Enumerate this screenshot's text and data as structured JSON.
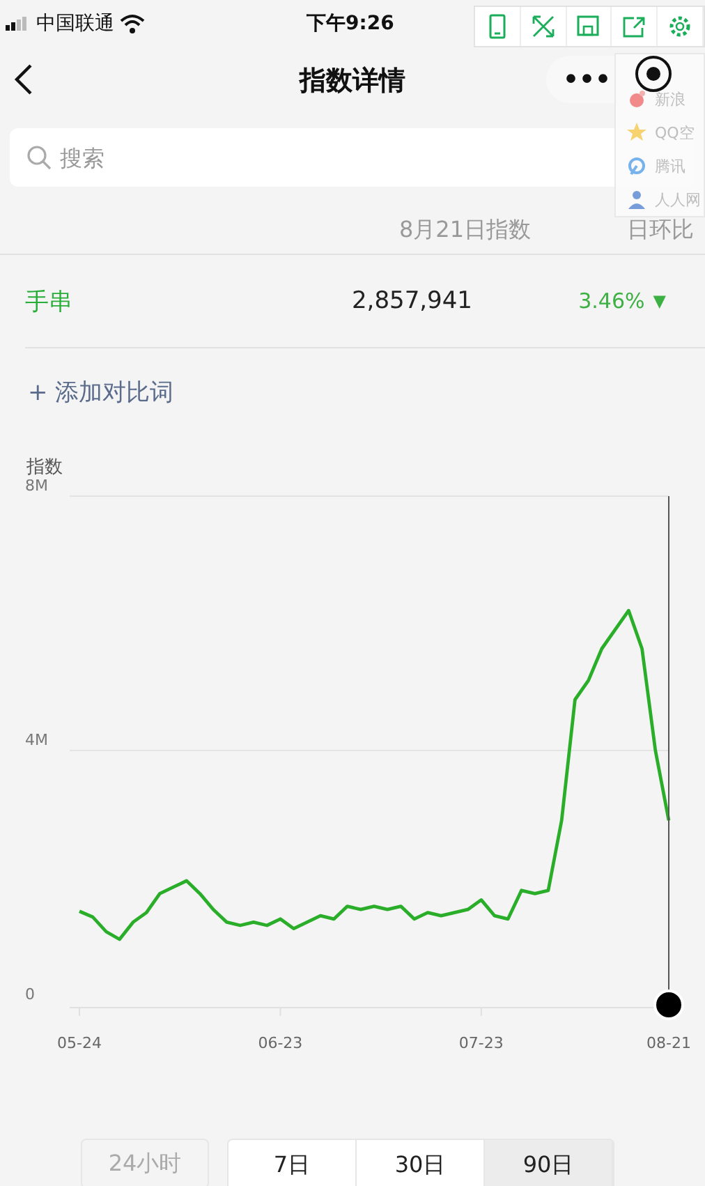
{
  "status_bar": {
    "carrier": "中国联通",
    "time": "下午9:26"
  },
  "nav": {
    "title": "指数详情",
    "menu": "•••"
  },
  "extension_toolbar": [
    {
      "kind": "phone"
    },
    {
      "kind": "expand"
    },
    {
      "kind": "save"
    },
    {
      "kind": "share"
    },
    {
      "kind": "settings"
    }
  ],
  "share_menu": [
    {
      "kind": "circle",
      "label": "新浪"
    },
    {
      "kind": "star",
      "label": "QQ空"
    },
    {
      "kind": "ring",
      "label": "腾讯"
    },
    {
      "kind": "person",
      "label": "人人网"
    }
  ],
  "search": {
    "placeholder": "搜索"
  },
  "index_table": {
    "columns": [
      "8月21日指数",
      "日环比"
    ],
    "rows": [
      {
        "keyword": "手串",
        "index": "2,857,941",
        "change": "3.46%",
        "trend": "▼"
      }
    ]
  },
  "add_compare": "+ 添加对比词",
  "chart_data": {
    "type": "line",
    "ylabel": "指数",
    "categories": [
      "05-24",
      null,
      null,
      null,
      null,
      null,
      null,
      null,
      null,
      null,
      null,
      null,
      null,
      null,
      null,
      "06-23",
      null,
      null,
      null,
      null,
      null,
      null,
      null,
      null,
      null,
      null,
      null,
      null,
      null,
      null,
      "07-23",
      null,
      null,
      null,
      null,
      null,
      null,
      null,
      null,
      null,
      null,
      null,
      null,
      null,
      "08-21"
    ],
    "series": [
      {
        "color": "#2aae2a",
        "values": [
          1.47,
          1.38,
          1.15,
          1.03,
          1.3,
          1.45,
          1.75,
          1.85,
          1.95,
          1.75,
          1.5,
          1.3,
          1.25,
          1.3,
          1.25,
          1.35,
          1.2,
          1.3,
          1.4,
          1.35,
          1.55,
          1.5,
          1.55,
          1.5,
          1.55,
          1.35,
          1.45,
          1.4,
          1.45,
          1.5,
          1.65,
          1.4,
          1.35,
          1.8,
          1.75,
          1.8,
          2.9,
          4.8,
          5.1,
          5.6,
          5.9,
          6.2,
          5.6,
          4.0,
          2.9
        ]
      }
    ],
    "ylim": [
      0,
      8
    ],
    "yticks": [
      {
        "value": 0,
        "label": "0"
      },
      {
        "value": 4,
        "label": "4M"
      },
      {
        "value": 8,
        "label": "8M"
      }
    ]
  },
  "ranges": [
    {
      "label": "24小时",
      "selected": false,
      "disabled": true
    },
    {
      "label": "7日",
      "selected": false,
      "disabled": false
    },
    {
      "label": "30日",
      "selected": false,
      "disabled": false
    },
    {
      "label": "90日",
      "selected": true,
      "disabled": false
    }
  ]
}
